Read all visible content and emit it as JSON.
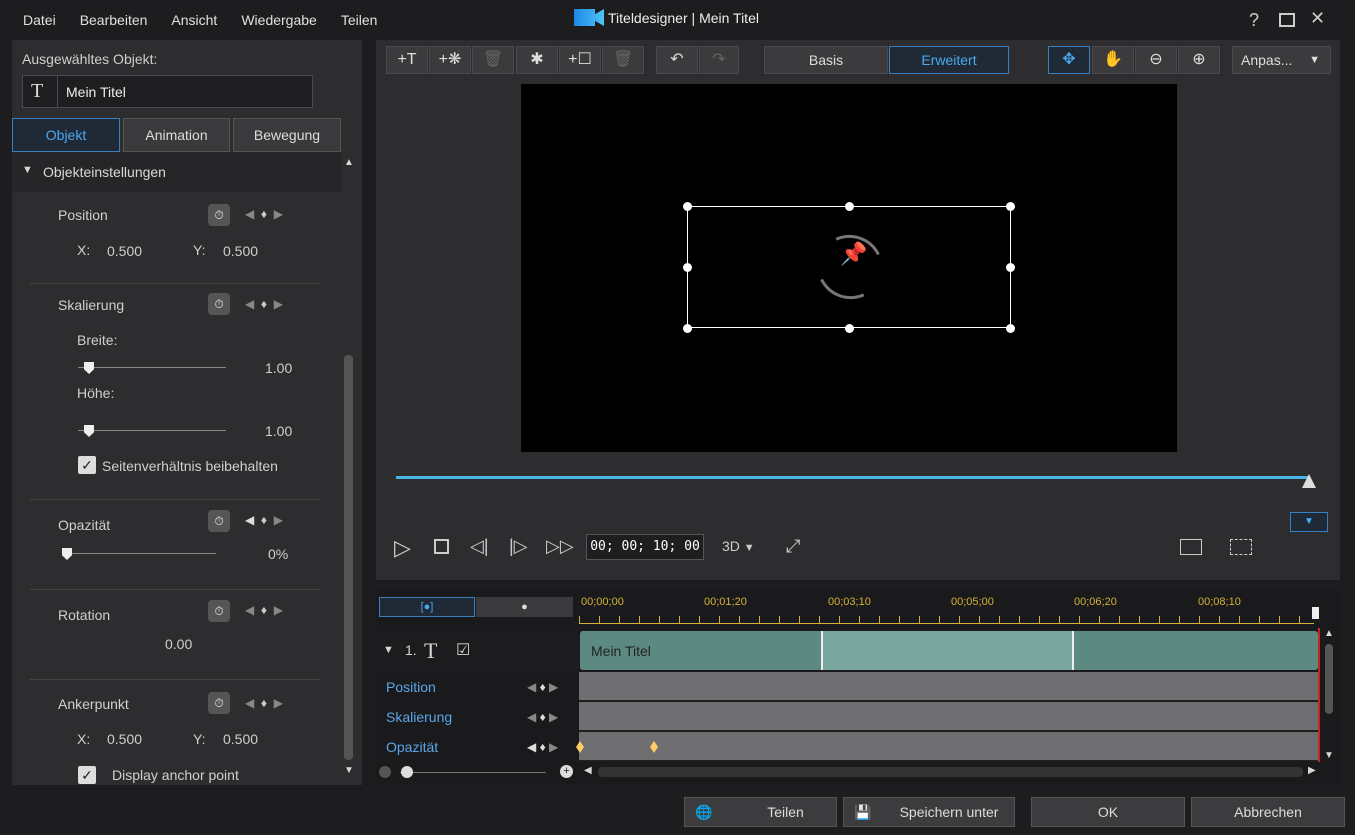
{
  "menu": [
    "Datei",
    "Bearbeiten",
    "Ansicht",
    "Wiedergabe",
    "Teilen"
  ],
  "window": {
    "title": "Titeldesigner",
    "separator": "|",
    "subtitle": "Mein Titel",
    "help": "?"
  },
  "left": {
    "selected_label": "Ausgewähltes Objekt:",
    "selected_value": "Mein Titel",
    "tabs": [
      "Objekt",
      "Animation",
      "Bewegung"
    ],
    "section": "Objekteinstellungen",
    "position": {
      "label": "Position",
      "x_label": "X:",
      "x": "0.500",
      "y_label": "Y:",
      "y": "0.500"
    },
    "scaling": {
      "label": "Skalierung",
      "width_label": "Breite:",
      "width": "1.00",
      "height_label": "Höhe:",
      "height": "1.00",
      "aspect_label": "Seitenverhältnis beibehalten",
      "aspect_checked": true
    },
    "opacity": {
      "label": "Opazität",
      "value": "0%",
      "fraction": 0
    },
    "rotation": {
      "label": "Rotation",
      "value": "0.00"
    },
    "anchor": {
      "label": "Ankerpunkt",
      "x_label": "X:",
      "x": "0.500",
      "y_label": "Y:",
      "y": "0.500",
      "display_label": "Display anchor point"
    }
  },
  "toolbar": {
    "mode_basic": "Basis",
    "mode_advanced": "Erweitert",
    "fit": "Anpas..."
  },
  "player": {
    "timecode": "00; 00; 10; 00",
    "mode3d": "3D",
    "progress": 1.0
  },
  "timeline": {
    "ticks": [
      "00;00;00",
      "00;01;20",
      "00;03;10",
      "00;05;00",
      "00;06;20",
      "00;08;10"
    ],
    "track_number": "1.",
    "clip": "Mein Titel",
    "rows": [
      "Position",
      "Skalierung",
      "Opazität"
    ]
  },
  "footer": {
    "share": "Teilen",
    "save_as": "Speichern unter",
    "ok": "OK",
    "cancel": "Abbrechen"
  }
}
